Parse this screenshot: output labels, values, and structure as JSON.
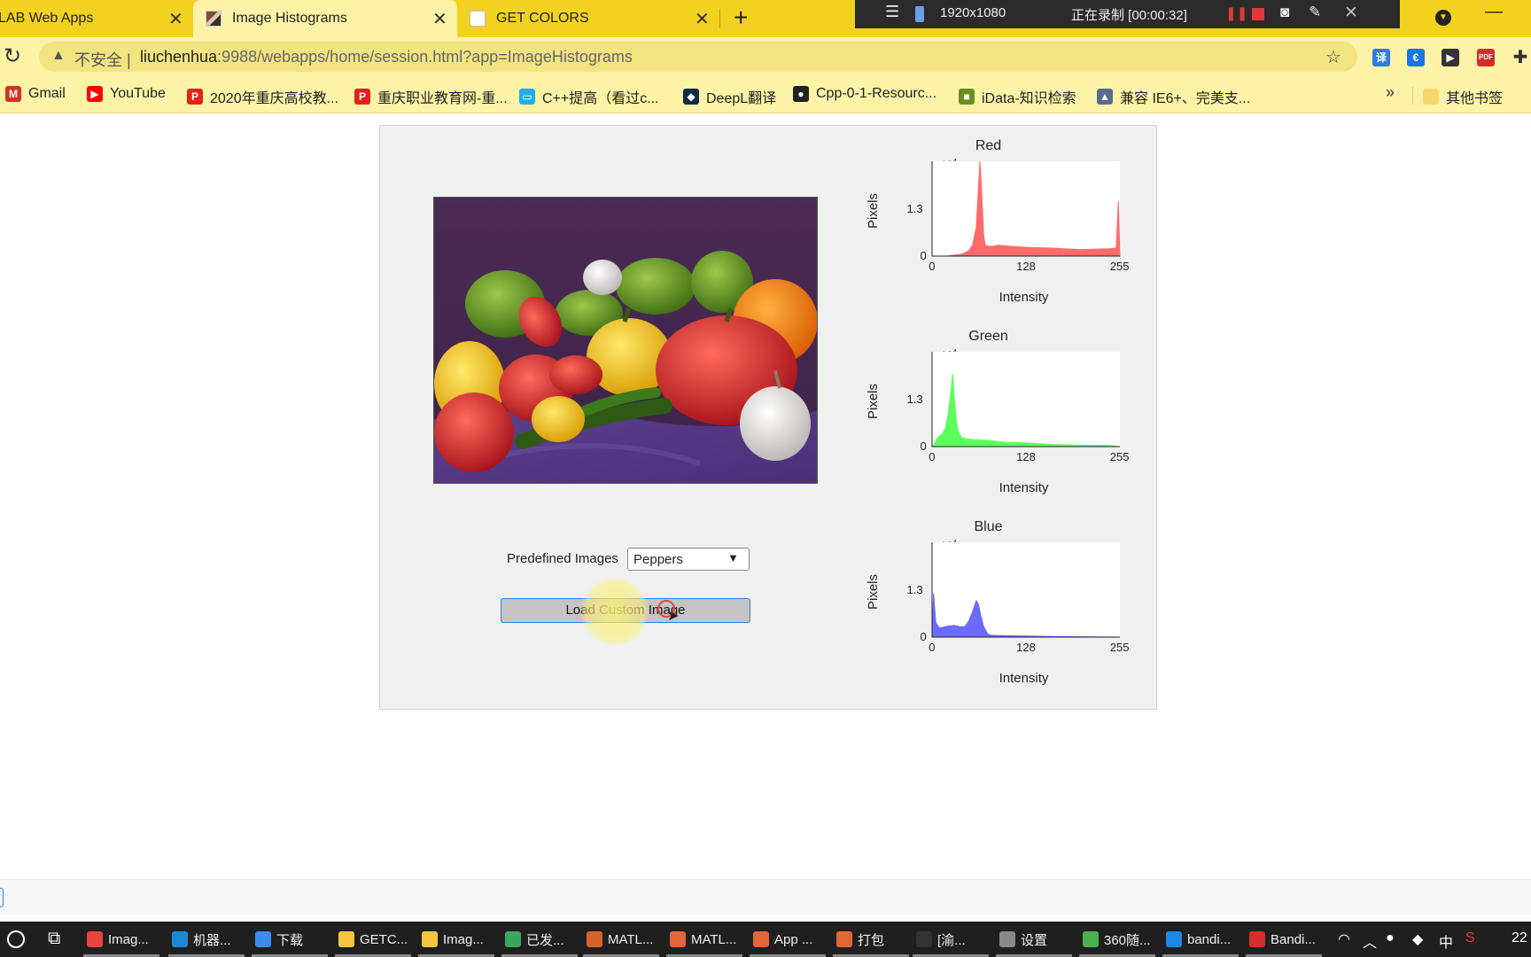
{
  "browser": {
    "tabs": [
      {
        "label": "LAB Web Apps",
        "active": false
      },
      {
        "label": "Image Histograms",
        "active": true
      },
      {
        "label": "GET COLORS",
        "active": false
      }
    ],
    "close_glyph": "✕",
    "new_tab_glyph": "+",
    "address": {
      "insecure_label": "不安全",
      "separator": "|",
      "url_host": "liuchenhua",
      "url_rest": ":9988/webapps/home/session.html?app=ImageHistograms"
    },
    "bookmarks": [
      {
        "label": "Gmail",
        "icon": "gmail-icon",
        "color": "#d93025",
        "glyph": "M"
      },
      {
        "label": "YouTube",
        "icon": "youtube-icon",
        "color": "#ff0000",
        "glyph": "▶"
      },
      {
        "label": "2020年重庆高校教...",
        "icon": "p-icon",
        "color": "#e2231a",
        "glyph": "P"
      },
      {
        "label": "重庆职业教育网-重...",
        "icon": "p-icon",
        "color": "#e2231a",
        "glyph": "P"
      },
      {
        "label": "C++提高（看过c...",
        "icon": "bilibili-icon",
        "color": "#23ade5",
        "glyph": "▭"
      },
      {
        "label": "DeepL翻译",
        "icon": "deepl-icon",
        "color": "#0f2b46",
        "glyph": "◆"
      },
      {
        "label": "Cpp-0-1-Resourc...",
        "icon": "github-icon",
        "color": "#222222",
        "glyph": "●"
      },
      {
        "label": "iData-知识检索",
        "icon": "idata-icon",
        "color": "#6b8e23",
        "glyph": "■"
      },
      {
        "label": "兼容 IE6+、完美支...",
        "icon": "triangle-icon",
        "color": "#5a6b8c",
        "glyph": "▲"
      }
    ],
    "more_bookmarks": "»",
    "other_bookmarks": "其他书签"
  },
  "recorder": {
    "resolution": "1920x1080",
    "status": "正在录制 [00:00:32]"
  },
  "app": {
    "predefined_label": "Predefined Images",
    "predefined_value": "Peppers",
    "load_button": "Load Custom Image",
    "histograms": [
      {
        "title": "Red",
        "color": "#ff6b6b",
        "ylabel": "Pixels",
        "xlabel": "Intensity",
        "exponent_base": "×10",
        "exponent_power": "4",
        "xticks": [
          "0",
          "128",
          "255"
        ],
        "yticks": [
          "0",
          "1.3"
        ]
      },
      {
        "title": "Green",
        "color": "#5dff5d",
        "ylabel": "Pixels",
        "xlabel": "Intensity",
        "exponent_base": "×10",
        "exponent_power": "4",
        "xticks": [
          "0",
          "128",
          "255"
        ],
        "yticks": [
          "0",
          "1.3"
        ]
      },
      {
        "title": "Blue",
        "color": "#6b6bff",
        "ylabel": "Pixels",
        "xlabel": "Intensity",
        "exponent_base": "×10",
        "exponent_power": "4",
        "xticks": [
          "0",
          "128",
          "255"
        ],
        "yticks": [
          "0",
          "1.3"
        ]
      }
    ]
  },
  "chart_data": [
    {
      "type": "area",
      "title": "Red",
      "xlabel": "Intensity",
      "ylabel": "Pixels",
      "xlim": [
        0,
        255
      ],
      "ylim": [
        0,
        2.6
      ],
      "y_unit_multiplier": "×10^4",
      "x": [
        0,
        20,
        40,
        50,
        55,
        60,
        62,
        65,
        67,
        70,
        72,
        75,
        80,
        90,
        100,
        128,
        160,
        200,
        240,
        250,
        253,
        255
      ],
      "y": [
        0,
        0,
        0.05,
        0.15,
        0.3,
        0.8,
        1.5,
        2.6,
        1.9,
        0.6,
        0.3,
        0.28,
        0.26,
        0.3,
        0.28,
        0.24,
        0.22,
        0.18,
        0.2,
        0.22,
        1.5,
        0
      ]
    },
    {
      "type": "area",
      "title": "Green",
      "xlabel": "Intensity",
      "ylabel": "Pixels",
      "xlim": [
        0,
        255
      ],
      "ylim": [
        0,
        2.6
      ],
      "y_unit_multiplier": "×10^4",
      "x": [
        0,
        3,
        6,
        10,
        14,
        18,
        22,
        26,
        28,
        30,
        33,
        36,
        40,
        50,
        70,
        100,
        130,
        160,
        200,
        240,
        255
      ],
      "y": [
        0,
        0.05,
        0.2,
        0.3,
        0.35,
        0.5,
        0.9,
        1.6,
        2.0,
        1.4,
        0.7,
        0.4,
        0.25,
        0.2,
        0.18,
        0.12,
        0.1,
        0.06,
        0.04,
        0.03,
        0
      ]
    },
    {
      "type": "area",
      "title": "Blue",
      "xlabel": "Intensity",
      "ylabel": "Pixels",
      "xlim": [
        0,
        255
      ],
      "ylim": [
        0,
        2.6
      ],
      "y_unit_multiplier": "×10^4",
      "x": [
        0,
        2,
        5,
        10,
        20,
        30,
        40,
        45,
        50,
        55,
        60,
        63,
        66,
        70,
        75,
        80,
        100,
        128,
        160,
        200,
        255
      ],
      "y": [
        0,
        1.2,
        0.4,
        0.25,
        0.3,
        0.32,
        0.28,
        0.3,
        0.45,
        0.7,
        1.0,
        0.9,
        0.6,
        0.3,
        0.1,
        0.05,
        0.04,
        0.03,
        0.02,
        0.01,
        0
      ]
    }
  ],
  "taskbar": {
    "items": [
      {
        "label": "Imag...",
        "icon": "chrome-icon",
        "color": "#e8453c"
      },
      {
        "label": "机器...",
        "icon": "edge-icon",
        "color": "#1a8ad6"
      },
      {
        "label": "下载",
        "icon": "download-icon",
        "color": "#3d8bf0"
      },
      {
        "label": "GETC...",
        "icon": "folder-icon",
        "color": "#f5c542"
      },
      {
        "label": "Imag...",
        "icon": "folder-icon",
        "color": "#f5c542"
      },
      {
        "label": "已发...",
        "icon": "photos-icon",
        "color": "#3aa55c"
      },
      {
        "label": "MATL...",
        "icon": "matlab-doc-icon",
        "color": "#d9602b"
      },
      {
        "label": "MATL...",
        "icon": "matlab-icon",
        "color": "#e16737"
      },
      {
        "label": "App ...",
        "icon": "matlab-app-icon",
        "color": "#e16737"
      },
      {
        "label": "打包",
        "icon": "matlab-pack-icon",
        "color": "#e16737"
      },
      {
        "label": "[渝...",
        "icon": "chat-icon",
        "color": "#333333"
      },
      {
        "label": "设置",
        "icon": "settings-icon",
        "color": "#888888"
      },
      {
        "label": "360随...",
        "icon": "360-icon",
        "color": "#4caf50"
      },
      {
        "label": "bandi...",
        "icon": "bandizip-icon",
        "color": "#1e88e5"
      },
      {
        "label": "Bandi...",
        "icon": "bandicam-icon",
        "color": "#d32f2f"
      }
    ],
    "tray_ime": "中",
    "tray_time": "22"
  }
}
